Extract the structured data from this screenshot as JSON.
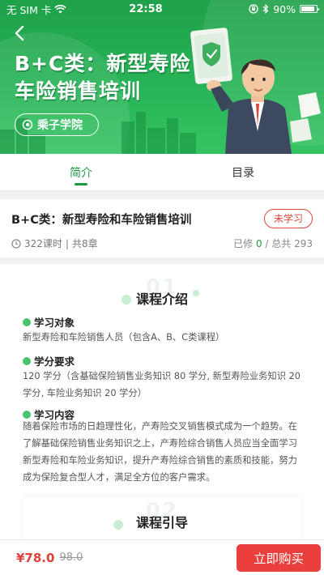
{
  "status_bar": {
    "carrier": "无 SIM 卡",
    "time": "22:58",
    "battery": "90%",
    "battery_level": 0.9
  },
  "hero": {
    "title_line1": "B+C类：新型寿险",
    "title_line2": "车险销售培训",
    "logo_text": "乘子学院"
  },
  "tabs": [
    {
      "label": "简介",
      "active": true
    },
    {
      "label": "目录",
      "active": false
    }
  ],
  "course": {
    "title": "B+C类：新型寿险和车险销售培训",
    "status": "未学习",
    "lessons": "322课时",
    "separator": "|",
    "chapters": "共8章",
    "progress_prefix": "已修",
    "progress_done": "0",
    "progress_suffix": "/ 总共 293"
  },
  "intro": {
    "number": "01",
    "title": "课程介绍",
    "sections": [
      {
        "heading": "学习对象",
        "text": "新型寿险和车险销售人员（包含A、B、C类课程）"
      },
      {
        "heading": "学分要求",
        "text": "120 学分（含基础保险销售业务知识 80 学分, 新型寿险业务知识 20 学分, 车险业务知识 20 学分）"
      },
      {
        "heading": "学习内容",
        "text": "随着保险市场的日趋理性化，产寿险交叉销售模式成为一个趋势。在了解基础保险销售业务知识之上，产寿险综合销售人员应当全面学习新型寿险和车险业务知识，提升产寿险综合销售的素质和技能，努力成为保险复合型人才，满足全方位的客户需求。"
      }
    ]
  },
  "guide": {
    "number": "02",
    "title": "课程引导"
  },
  "purchase": {
    "price": "¥78.0",
    "original_price": "98.0",
    "buy_label": "立即购买"
  },
  "colors": {
    "brand_green": "#1e9a45",
    "price_red": "#e0403b",
    "buy_button": "#ea3f3c"
  }
}
